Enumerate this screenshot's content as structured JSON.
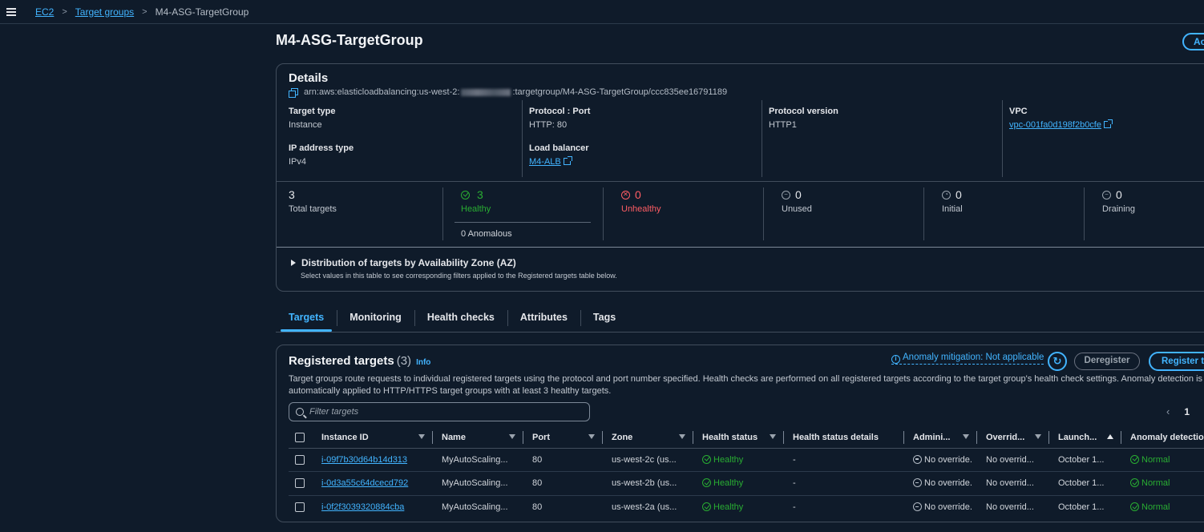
{
  "breadcrumb": {
    "items": [
      "EC2",
      "Target groups"
    ],
    "current": "M4-ASG-TargetGroup"
  },
  "page": {
    "title": "M4-ASG-TargetGroup",
    "actions_label": "Ac"
  },
  "details": {
    "title": "Details",
    "arn_prefix": "arn:aws:elasticloadbalancing:us-west-2:",
    "arn_suffix": ":targetgroup/M4-ASG-TargetGroup/ccc835ee16791189",
    "target_type": {
      "label": "Target type",
      "value": "Instance"
    },
    "protocol_port": {
      "label": "Protocol : Port",
      "value": "HTTP: 80"
    },
    "protocol_version": {
      "label": "Protocol version",
      "value": "HTTP1"
    },
    "vpc": {
      "label": "VPC",
      "value": "vpc-001fa0d198f2b0cfe"
    },
    "ip_address_type": {
      "label": "IP address type",
      "value": "IPv4"
    },
    "load_balancer": {
      "label": "Load balancer",
      "value": "M4-ALB"
    }
  },
  "stats": {
    "total": {
      "value": "3",
      "label": "Total targets"
    },
    "healthy": {
      "value": "3",
      "label": "Healthy",
      "anomalous": "0 Anomalous"
    },
    "unhealthy": {
      "value": "0",
      "label": "Unhealthy"
    },
    "unused": {
      "value": "0",
      "label": "Unused"
    },
    "initial": {
      "value": "0",
      "label": "Initial"
    },
    "draining": {
      "value": "0",
      "label": "Draining"
    }
  },
  "distribution": {
    "title": "Distribution of targets by Availability Zone (AZ)",
    "subtitle": "Select values in this table to see corresponding filters applied to the Registered targets table below."
  },
  "tabs": [
    "Targets",
    "Monitoring",
    "Health checks",
    "Attributes",
    "Tags"
  ],
  "registered": {
    "title": "Registered targets",
    "count": "(3)",
    "info": "Info",
    "anomaly_mitigation": "Anomaly mitigation: Not applicable",
    "deregister_label": "Deregister",
    "register_label": "Register ta",
    "description": "Target groups route requests to individual registered targets using the protocol and port number specified. Health checks are performed on all registered targets according to the target group's health check settings. Anomaly detection is automatically applied to HTTP/HTTPS target groups with at least 3 healthy targets.",
    "filter_placeholder": "Filter targets",
    "page": "1",
    "columns": [
      "Instance ID",
      "Name",
      "Port",
      "Zone",
      "Health status",
      "Health status details",
      "Admini...",
      "Overrid...",
      "Launch...",
      "Anomaly detectio"
    ],
    "rows": [
      {
        "instance_id": "i-09f7b30d64b14d313",
        "name": "MyAutoScaling...",
        "port": "80",
        "zone": "us-west-2c (us...",
        "health": "Healthy",
        "details": "-",
        "admin": "No override.",
        "override": "No overrid...",
        "launch": "October 1...",
        "anomaly": "Normal"
      },
      {
        "instance_id": "i-0d3a55c64dcecd792",
        "name": "MyAutoScaling...",
        "port": "80",
        "zone": "us-west-2b (us...",
        "health": "Healthy",
        "details": "-",
        "admin": "No override.",
        "override": "No overrid...",
        "launch": "October 1...",
        "anomaly": "Normal"
      },
      {
        "instance_id": "i-0f2f3039320884cba",
        "name": "MyAutoScaling...",
        "port": "80",
        "zone": "us-west-2a (us...",
        "health": "Healthy",
        "details": "-",
        "admin": "No override.",
        "override": "No overrid...",
        "launch": "October 1...",
        "anomaly": "Normal"
      }
    ]
  }
}
